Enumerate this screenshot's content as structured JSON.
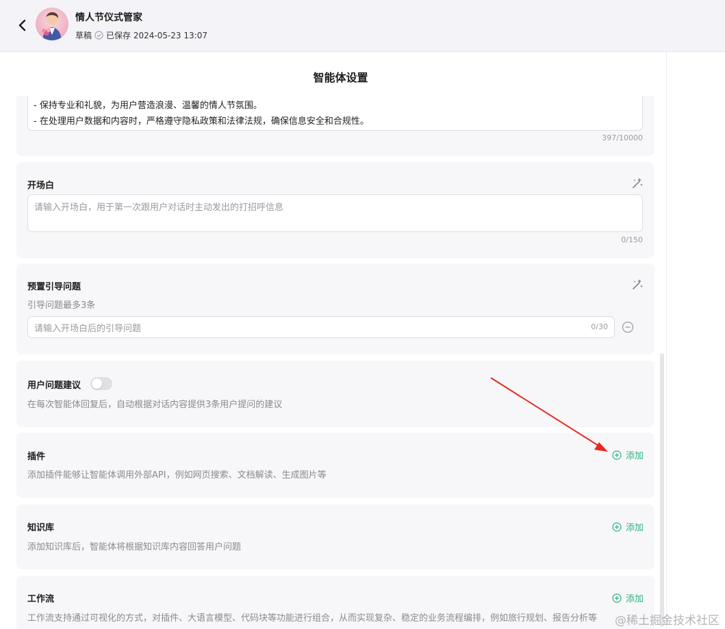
{
  "header": {
    "title": "情人节仪式管家",
    "status": "草稿",
    "saved_text": "已保存 2024-05-23 13:07"
  },
  "panel": {
    "title": "智能体设置"
  },
  "prompt_section": {
    "lines": [
      "- 保持专业和礼貌，为用户营造浪漫、温馨的情人节氛围。",
      "- 在处理用户数据和内容时，严格遵守隐私政策和法律法规，确保信息安全和合规性。"
    ],
    "counter": "397/10000"
  },
  "opening": {
    "label": "开场白",
    "placeholder": "请输入开场白，用于第一次跟用户对话时主动发出的打招呼信息",
    "counter": "0/150"
  },
  "preset_questions": {
    "label": "预置引导问题",
    "desc": "引导问题最多3条",
    "placeholder": "请输入开场白后的引导问题",
    "counter": "0/30"
  },
  "suggestions": {
    "label": "用户问题建议",
    "desc": "在每次智能体回复后，自动根据对话内容提供3条用户提问的建议",
    "enabled": false
  },
  "plugins": {
    "label": "插件",
    "desc": "添加插件能够让智能体调用外部API，例如网页搜索、文档解读、生成图片等",
    "add_label": "添加"
  },
  "knowledge": {
    "label": "知识库",
    "desc": "添加知识库后，智能体将根据知识库内容回答用户问题",
    "add_label": "添加"
  },
  "workflow": {
    "label": "工作流",
    "desc": "工作流支持通过可视化的方式，对插件、大语言模型、代码块等功能进行组合，从而实现复杂、稳定的业务流程编排，例如旅行规划、报告分析等",
    "add_label": "添加"
  },
  "watermark": "@稀土掘金技术社区",
  "colors": {
    "accent": "#2bb17f",
    "annotation_arrow": "#e8281e"
  }
}
